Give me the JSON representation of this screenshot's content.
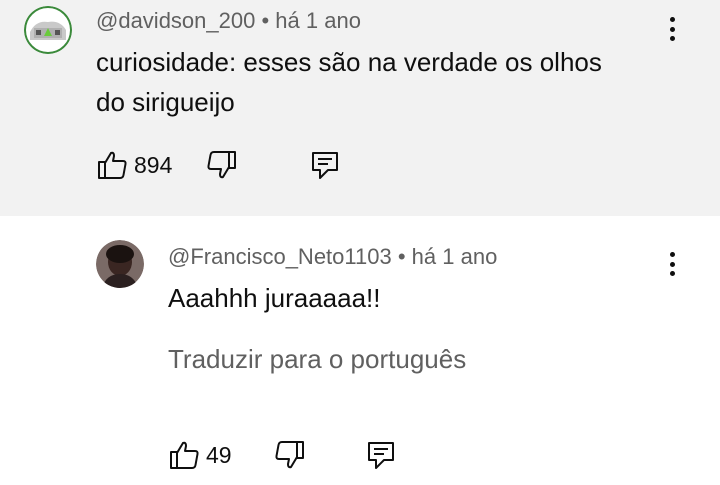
{
  "parent": {
    "username": "@davidson_200",
    "separator": "•",
    "timestamp": "há 1 ano",
    "text_line1": "curiosidade: esses são na verdade os olhos",
    "text_line2": "do sirigueijo",
    "likes": "894",
    "icons": {
      "like": "thumbs-up-icon",
      "dislike": "thumbs-down-icon",
      "reply": "reply-comment-icon",
      "menu": "more-vertical-icon"
    }
  },
  "reply": {
    "username": "@Francisco_Neto1103",
    "separator": "•",
    "timestamp": "há 1 ano",
    "text": "Aaahhh juraaaaa!!",
    "translate_label": "Traduzir para o português",
    "likes": "49"
  },
  "colors": {
    "parent_bg": "#f2f2f2",
    "meta_text": "#606060",
    "primary_text": "#0f0f0f"
  }
}
